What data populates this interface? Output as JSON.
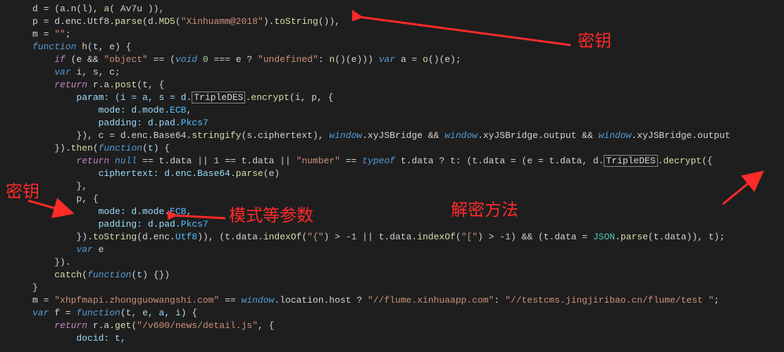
{
  "code": {
    "l1_a": "d = (a.",
    "l1_b": "n",
    "l1_c": "(l), ",
    "l1_d": "a",
    "l1_e": "( Av7u )),",
    "l2_a": "p = d.enc.Utf8.",
    "l2_b": "parse",
    "l2_c": "(d.",
    "l2_d": "MD5",
    "l2_e": "(",
    "l2_f": "\"Xinhuamm@2018\"",
    "l2_g": ").",
    "l2_h": "toString",
    "l2_i": "()),",
    "l3_a": "m = ",
    "l3_b": "\"\"",
    "l3_c": ";",
    "l4_a": "function",
    "l4_b": " h",
    "l4_c": "(",
    "l4_d": "t",
    "l4_e": ", ",
    "l4_f": "e",
    "l4_g": ") {",
    "l5_a": "if",
    "l5_b": " (e && ",
    "l5_c": "\"object\"",
    "l5_d": " == (",
    "l5_e": "void",
    "l5_f": " ",
    "l5_g": "0",
    "l5_h": " === e ? ",
    "l5_i": "\"undefined\"",
    "l5_j": ": ",
    "l5_k": "n",
    "l5_l": "()(e))) ",
    "l5_m": "var",
    "l5_n": " a = ",
    "l5_o": "o",
    "l5_p": "()(e);",
    "l6_a": "var",
    "l6_b": " i, s, c;",
    "l7_a": "return",
    "l7_b": " r.a.",
    "l7_c": "post",
    "l7_d": "(t, {",
    "l8_a": "param: (i = a, s = d.",
    "l8_b": "TripleDES",
    "l8_c": ".",
    "l8_d": "encrypt",
    "l8_e": "(i, p, {",
    "l9_a": "mode: d.mode.",
    "l9_b": "ECB",
    "l9_c": ",",
    "l10_a": "padding: d.pad.",
    "l10_b": "Pkcs7",
    "l11_a": "}), c = d.enc.Base64.",
    "l11_b": "stringify",
    "l11_c": "(s.ciphertext), ",
    "l11_d": "window",
    "l11_e": ".xyJSBridge && ",
    "l11_f": "window",
    "l11_g": ".xyJSBridge.output && ",
    "l11_h": "window",
    "l11_i": ".xyJSBridge.output",
    "l12_a": "}).",
    "l12_b": "then",
    "l12_c": "(",
    "l12_d": "function",
    "l12_e": "(",
    "l12_f": "t",
    "l12_g": ") {",
    "l13_a": "return",
    "l13_b": " ",
    "l13_c": "null",
    "l13_d": " == t.data || ",
    "l13_e": "1",
    "l13_f": " == t.data || ",
    "l13_g": "\"number\"",
    "l13_h": " == ",
    "l13_i": "typeof",
    "l13_j": " t.data ? t: (t.data = (e = t.data, d.",
    "l13_k": "TripleDES",
    "l13_l": ".",
    "l13_m": "decrypt",
    "l13_n": "({",
    "l14_a": "ciphertext: d.enc.Base64.",
    "l14_b": "parse",
    "l14_c": "(e)",
    "l15_a": "},",
    "l16_a": "p, {",
    "l17_a": "mode: d.mode.",
    "l17_b": "ECB",
    "l17_c": ",",
    "l18_a": "padding: d.pad.",
    "l18_b": "Pkcs7",
    "l19_a": "}).",
    "l19_b": "toString",
    "l19_c": "(d.enc.",
    "l19_d": "Utf8",
    "l19_e": ")), (t.data.",
    "l19_f": "indexOf",
    "l19_g": "(",
    "l19_h": "\"{\"",
    "l19_i": ") > -",
    "l19_j": "1",
    "l19_k": " || t.data.",
    "l19_l": "indexOf",
    "l19_m": "(",
    "l19_n": "\"[\"",
    "l19_o": ") > -",
    "l19_p": "1",
    "l19_q": ") && (t.data = ",
    "l19_r": "JSON",
    "l19_s": ".",
    "l19_t": "parse",
    "l19_u": "(t.data)), t);",
    "l20_a": "var",
    "l20_b": " e",
    "l21_a": "}).",
    "l22_a": "catch",
    "l22_b": "(",
    "l22_c": "function",
    "l22_d": "(",
    "l22_e": "t",
    "l22_f": ") {})",
    "l23_a": "}",
    "l24_a": "m = ",
    "l24_b": "\"xhpfmapi.zhongguowangshi.com\"",
    "l24_c": " == ",
    "l24_d": "window",
    "l24_e": ".location.host ? ",
    "l24_f": "\"//flume.xinhuaapp.com\"",
    "l24_g": ": ",
    "l24_h": "\"//testcms.jingjiribao.cn/flume/test \"",
    "l24_i": ";",
    "l25_a": "var",
    "l25_b": " ",
    "l25_c": "f",
    "l25_d": " = ",
    "l25_e": "function",
    "l25_f": "(",
    "l25_g": "t",
    "l25_h": ", ",
    "l25_i": "e",
    "l25_j": ", ",
    "l25_k": "a",
    "l25_l": ", ",
    "l25_m": "i",
    "l25_n": ") {",
    "l26_a": "return",
    "l26_b": " r.a.",
    "l26_c": "get",
    "l26_d": "(",
    "l26_e": "\"/v600/news/detail.js\"",
    "l26_f": ", {",
    "l27_a": "docid: t,"
  },
  "annotations": {
    "key1": "密钥",
    "key2": "密钥",
    "mode_params": "模式等参数",
    "decrypt_method": "解密方法"
  }
}
